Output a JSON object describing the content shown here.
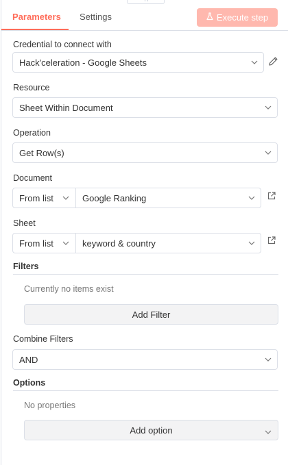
{
  "tabs": {
    "parameters": "Parameters",
    "settings": "Settings"
  },
  "toolbar": {
    "execute_label": "Execute step"
  },
  "credential": {
    "label": "Credential to connect with",
    "value": "Hack'celeration - Google Sheets"
  },
  "resource": {
    "label": "Resource",
    "value": "Sheet Within Document"
  },
  "operation": {
    "label": "Operation",
    "value": "Get Row(s)"
  },
  "document": {
    "label": "Document",
    "mode": "From list",
    "value": "Google Ranking"
  },
  "sheet": {
    "label": "Sheet",
    "mode": "From list",
    "value": "keyword & country"
  },
  "filters": {
    "title": "Filters",
    "empty_text": "Currently no items exist",
    "add_label": "Add Filter"
  },
  "combine": {
    "label": "Combine Filters",
    "value": "AND"
  },
  "options": {
    "title": "Options",
    "empty_text": "No properties",
    "add_label": "Add option"
  },
  "colors": {
    "accent": "#ff6d5a",
    "accent_disabled": "#ffb8ae",
    "border": "#dbdfe7"
  },
  "icons": [
    "flask-icon",
    "pencil-icon",
    "external-link-icon",
    "chevron-down-icon"
  ]
}
